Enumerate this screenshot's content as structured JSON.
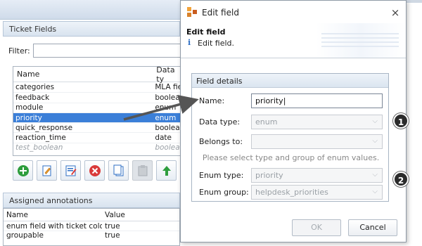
{
  "background": {
    "panel_title": "Ticket Fields",
    "filter_label": "Filter:",
    "filter_value": "",
    "fields_table": {
      "columns": [
        "Name",
        "Data ty"
      ],
      "rows": [
        {
          "name": "categories",
          "type": "MLA fiel",
          "state": "normal"
        },
        {
          "name": "feedback",
          "type": "boolean",
          "state": "normal"
        },
        {
          "name": "module",
          "type": "enum",
          "state": "normal"
        },
        {
          "name": "priority",
          "type": "enum",
          "state": "selected"
        },
        {
          "name": "quick_response",
          "type": "boolean",
          "state": "normal"
        },
        {
          "name": "reaction_time",
          "type": "date",
          "state": "normal"
        },
        {
          "name": "test_boolean",
          "type": "boolean",
          "state": "disabled"
        }
      ]
    },
    "toolbar_icons": [
      "add-icon",
      "edit-icon",
      "edit-properties-icon",
      "delete-icon",
      "copy-icon",
      "paste-icon",
      "move-up-icon"
    ],
    "annotations_title": "Assigned annotations",
    "annotations_table": {
      "columns": [
        "Name",
        "Value"
      ],
      "rows": [
        {
          "name": "enum field with ticket color",
          "value": "true"
        },
        {
          "name": "groupable",
          "value": "true"
        }
      ]
    }
  },
  "dialog": {
    "title": "Edit field",
    "close_glyph": "×",
    "header_title": "Edit field",
    "info_glyph": "i",
    "header_description": "Edit field.",
    "group_title": "Field details",
    "name_label": "Name:",
    "name_value": "priority",
    "data_type_label": "Data type:",
    "data_type_value": "enum",
    "belongs_to_label": "Belongs to:",
    "belongs_to_value": "",
    "hint": "Please select type and group of enum values.",
    "enum_type_label": "Enum type:",
    "enum_type_value": "priority",
    "enum_group_label": "Enum group:",
    "enum_group_value": "helpdesk_priorities",
    "ok_label": "OK",
    "cancel_label": "Cancel"
  },
  "callouts": [
    "1",
    "2"
  ],
  "colors": {
    "selection": "#3b7fd8",
    "callout": "#2b2b2b",
    "add_icon": "#2e9d3d",
    "delete_icon": "#d93a3a",
    "edit_icon": "#2f6fc4"
  }
}
